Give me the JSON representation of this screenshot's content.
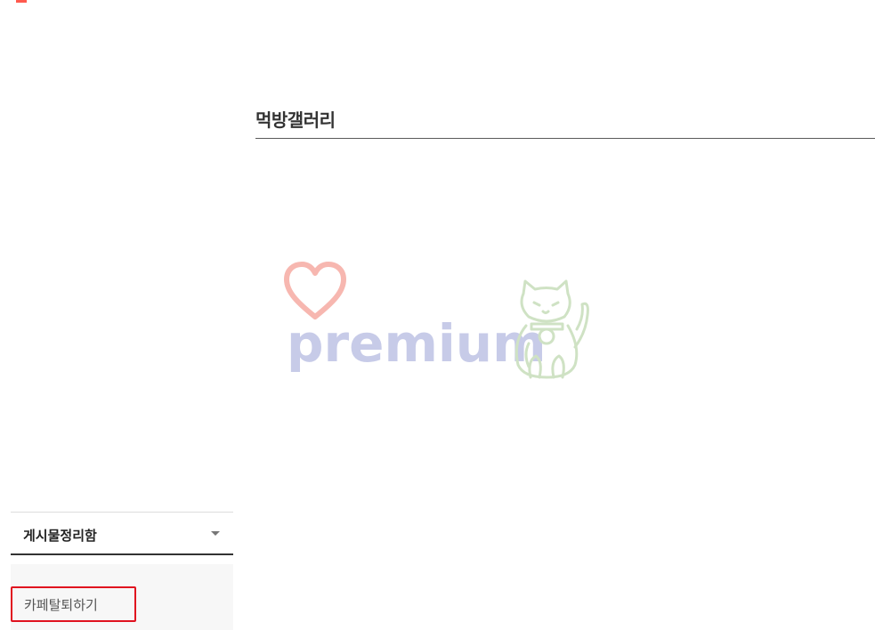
{
  "board": {
    "title": "먹방갤러리"
  },
  "banner": {
    "word": "premium",
    "icons": [
      "heart-icon",
      "lucky-cat-icon"
    ],
    "colors": {
      "heart": "#f7b7b0",
      "text": "#c7cbe8",
      "cat": "#cfe2c4"
    }
  },
  "sidebar": {
    "folder_menu_label": "게시물정리함",
    "leave_cafe_label": "카페탈퇴하기",
    "highlight_color": "#e0121f"
  }
}
